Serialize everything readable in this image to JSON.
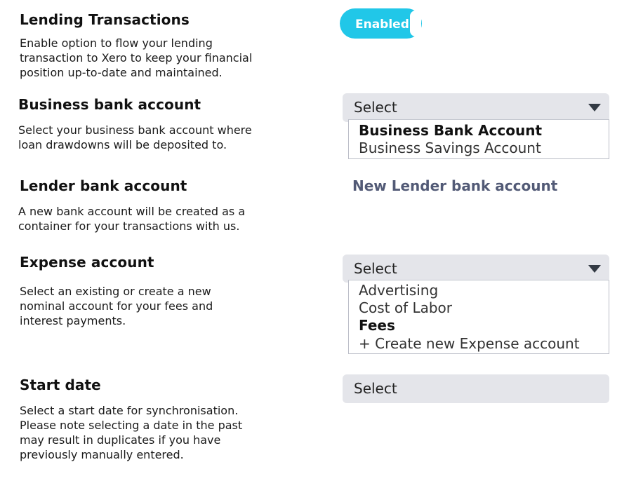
{
  "lending": {
    "title": "Lending Transactions",
    "desc": [
      "Enable option to flow your lending",
      "transaction to Xero to keep your financial",
      "position up-to-date and maintained."
    ],
    "toggle_label": "Enabled"
  },
  "business_bank": {
    "title": "Business bank account",
    "desc": [
      "Select your business bank account where",
      "loan drawdowns will be deposited to."
    ],
    "select_value": "Select",
    "options": [
      "Business Bank Account",
      "Business Savings Account"
    ]
  },
  "lender_bank": {
    "title": "Lender bank account",
    "desc": [
      "A new bank account will be created as a",
      "container for your transactions with us."
    ],
    "link": "New Lender bank account"
  },
  "expense": {
    "title": "Expense account",
    "desc": [
      "Select an existing or create a new",
      "nominal account for your fees and",
      "interest payments."
    ],
    "select_value": "Select",
    "options": [
      "Advertising",
      "Cost of Labor",
      "Fees",
      "+ Create new Expense account"
    ]
  },
  "start_date": {
    "title": "Start date",
    "desc": [
      "Select a start date for synchronisation.",
      "Please note selecting a date in the past",
      "may result in duplicates if you have",
      "previously manually entered."
    ],
    "select_value": "Select"
  },
  "colors": {
    "toggle": "#21c7e8",
    "select_bg": "#e4e5ea",
    "link": "#525a76"
  }
}
